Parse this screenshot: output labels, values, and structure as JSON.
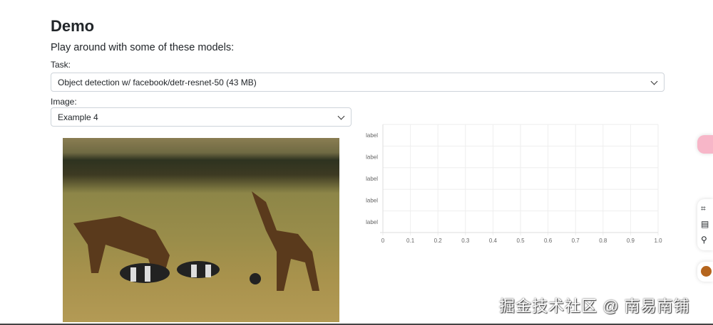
{
  "title": "Demo",
  "subtitle": "Play around with some of these models:",
  "task": {
    "label": "Task:",
    "value": "Object detection w/ facebook/detr-resnet-50 (43 MB)"
  },
  "image": {
    "label": "Image:",
    "value": "Example 4"
  },
  "chart_data": {
    "type": "bar",
    "categories": [
      "label",
      "label",
      "label",
      "label",
      "label"
    ],
    "values": [
      0,
      0,
      0,
      0,
      0
    ],
    "xlim": [
      0,
      1
    ],
    "xticks": [
      "0",
      "0.1",
      "0.2",
      "0.3",
      "0.4",
      "0.5",
      "0.6",
      "0.7",
      "0.8",
      "0.9",
      "1.0"
    ],
    "grid": true,
    "orientation": "horizontal"
  },
  "watermark": "掘金技术社区 @ 南易南铺"
}
